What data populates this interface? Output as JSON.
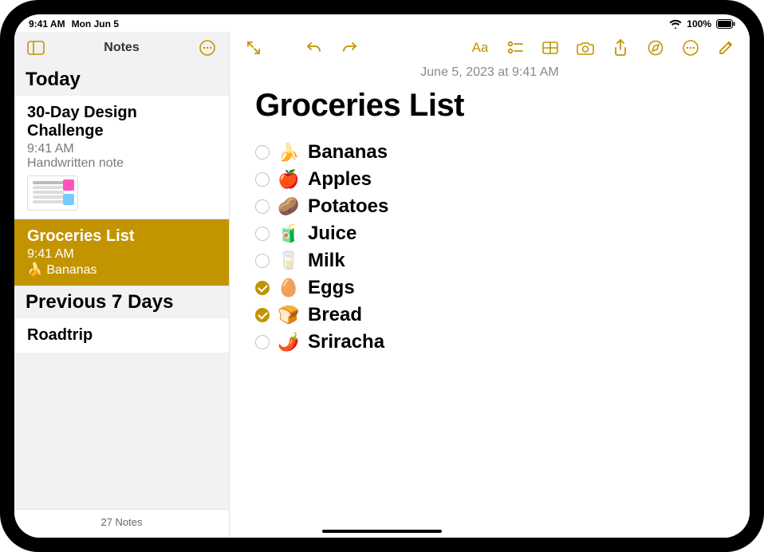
{
  "status": {
    "time": "9:41 AM",
    "date": "Mon Jun 5",
    "battery_pct": "100%"
  },
  "sidebar": {
    "title": "Notes",
    "sections": {
      "today": "Today",
      "prev7": "Previous 7 Days"
    },
    "items": [
      {
        "title": "30-Day Design Challenge",
        "time": "9:41 AM",
        "preview": "Handwritten note",
        "selected": false,
        "thumb": true
      },
      {
        "title": "Groceries List",
        "time": "9:41 AM",
        "preview_emoji": "🍌",
        "preview": "Bananas",
        "selected": true
      },
      {
        "title": "Roadtrip",
        "selected": false
      }
    ],
    "footer": "27 Notes"
  },
  "note": {
    "meta": "June 5, 2023 at 9:41 AM",
    "title": "Groceries List",
    "items": [
      {
        "emoji": "🍌",
        "label": "Bananas",
        "checked": false
      },
      {
        "emoji": "🍎",
        "label": "Apples",
        "checked": false
      },
      {
        "emoji": "🥔",
        "label": "Potatoes",
        "checked": false
      },
      {
        "emoji": "🧃",
        "label": "Juice",
        "checked": false
      },
      {
        "emoji": "🥛",
        "label": "Milk",
        "checked": false
      },
      {
        "emoji": "🥚",
        "label": "Eggs",
        "checked": true
      },
      {
        "emoji": "🍞",
        "label": "Bread",
        "checked": true
      },
      {
        "emoji": "🌶️",
        "label": "Sriracha",
        "checked": false
      }
    ]
  },
  "colors": {
    "accent": "#c29400"
  }
}
